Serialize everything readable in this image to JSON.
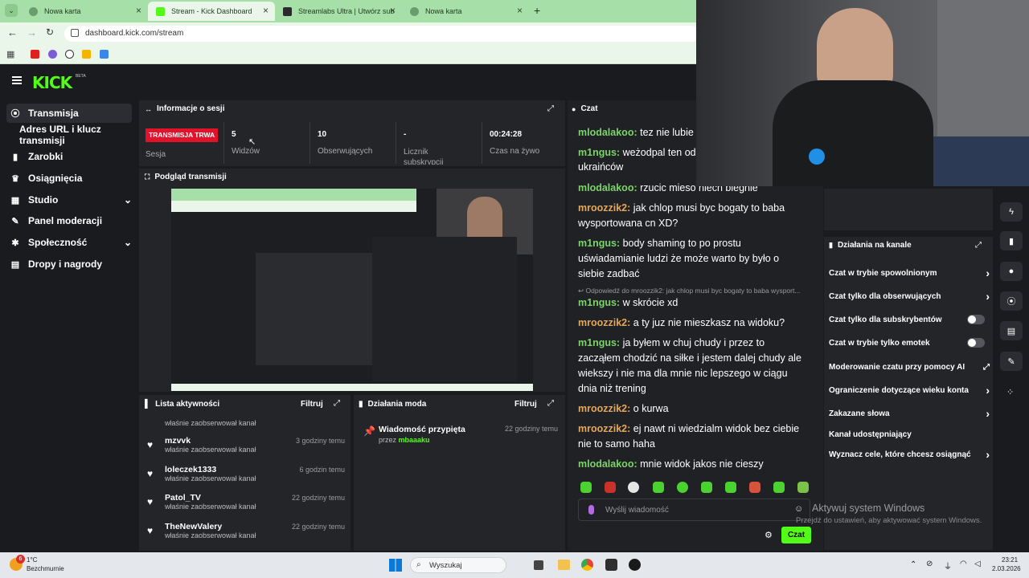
{
  "browser": {
    "tabs": [
      {
        "label": "Nowa karta"
      },
      {
        "label": "Stream - Kick Dashboard"
      },
      {
        "label": "Streamlabs Ultra | Utwórz subsk"
      },
      {
        "label": "Nowa karta"
      }
    ],
    "url": "dashboard.kick.com/stream"
  },
  "app": {
    "logo": "KICK",
    "logo_badge": "BETA"
  },
  "sidebar": {
    "items": [
      {
        "label": "Transmisja",
        "icon": "broadcast-icon"
      },
      {
        "label": "Adres URL i klucz transmisji"
      },
      {
        "label": "Zarobki",
        "icon": "chart-icon"
      },
      {
        "label": "Osiągnięcia",
        "icon": "trophy-icon"
      },
      {
        "label": "Studio",
        "icon": "grid-icon"
      },
      {
        "label": "Panel moderacji",
        "icon": "wrench-icon"
      },
      {
        "label": "Społeczność",
        "icon": "people-icon"
      },
      {
        "label": "Dropy i nagrody",
        "icon": "gift-icon"
      }
    ]
  },
  "session": {
    "title": "Informacje o sesji",
    "live_badge": "TRANSMISJA TRWA",
    "session_label": "Sesja",
    "stats": [
      {
        "value": "5",
        "label": "Widzów"
      },
      {
        "value": "10",
        "label": "Obserwujących"
      },
      {
        "value": "-",
        "label": "Licznik subskrypcji"
      },
      {
        "value": "00:24:28",
        "label": "Czas na żywo"
      }
    ]
  },
  "preview": {
    "title": "Podgląd transmisji"
  },
  "activity": {
    "title": "Lista aktywności",
    "filter_label": "Filtruj",
    "first_sub": "właśnie zaobserwował kanał",
    "rows": [
      {
        "name": "mzvvk",
        "sub": "właśnie zaobserwował kanał",
        "time": "3 godziny temu"
      },
      {
        "name": "loleczek1333",
        "sub": "właśnie zaobserwował kanał",
        "time": "6 godzin temu"
      },
      {
        "name": "Patol_TV",
        "sub": "właśnie zaobserwował kanał",
        "time": "22 godziny temu"
      },
      {
        "name": "TheNewValery",
        "sub": "właśnie zaobserwował kanał",
        "time": "22 godziny temu"
      }
    ]
  },
  "mod": {
    "title": "Działania moda",
    "filter_label": "Filtruj",
    "item_title": "Wiadomość przypięta",
    "item_by": "przez",
    "item_user": "mbaaaku",
    "item_time": "22 godziny temu"
  },
  "chat": {
    "title": "Czat",
    "messages": [
      {
        "user": "mlodalakoo:",
        "text": " tez nie lubie ",
        "style": "u1"
      },
      {
        "user": "m1ngus:",
        "text": " weżodpal ten ode",
        "style": "u3"
      },
      {
        "user": "",
        "text": "ukraińców",
        "style": ""
      },
      {
        "user": "mlodalakoo:",
        "text": " rzucic mieso niech biegnie",
        "style": "u1"
      },
      {
        "user": "mroozzik2:",
        "text": " jak chlop musi byc bogaty to baba",
        "style": "u2"
      },
      {
        "user": "",
        "text": "wysportowana cn XD?",
        "style": ""
      },
      {
        "user": "m1ngus:",
        "text": " body shaming to po prostu",
        "style": "u3"
      },
      {
        "user": "",
        "text": "uświadamianie ludzi że może warto by było o",
        "style": ""
      },
      {
        "user": "",
        "text": "siebie zadbać",
        "style": ""
      }
    ],
    "reply_hint": "Odpowiedź do mroozzik2: jak chlop musi byc bogaty to baba wysport...",
    "messages2": [
      {
        "user": "m1ngus:",
        "text": " w skrócie xd",
        "style": "u3"
      },
      {
        "user": "mroozzik2:",
        "text": " a ty juz nie mieszkasz na widoku?",
        "style": "u2"
      },
      {
        "user": "m1ngus:",
        "text": " ja byłem w chuj chudy i przez to",
        "style": "u3"
      },
      {
        "user": "",
        "text": "zacząłem chodzić na siłke i jestem dalej chudy ale",
        "style": ""
      },
      {
        "user": "",
        "text": "wiekszy i nie ma dla mnie nic lepszego w ciągu",
        "style": ""
      },
      {
        "user": "",
        "text": "dnia niż trening",
        "style": ""
      },
      {
        "user": "mroozzik2:",
        "text": " o kurwa",
        "style": "u2"
      },
      {
        "user": "mroozzik2:",
        "text": " ej nawt ni wiedzialm widok bez ciebie",
        "style": "u2"
      },
      {
        "user": "",
        "text": "nie to samo haha",
        "style": ""
      },
      {
        "user": "mlodalakoo:",
        "text": " mnie widok jakos nie cieszy",
        "style": "u1"
      }
    ],
    "input_placeholder": "Wyślij wiadomość",
    "send_label": "Czat"
  },
  "channel": {
    "title": "Działania na kanale",
    "items": [
      {
        "label": "Czat w trybie spowolnionym",
        "control": "chevron"
      },
      {
        "label": "Czat tylko dla obserwujących",
        "control": "chevron"
      },
      {
        "label": "Czat tylko dla subskrybentów",
        "control": "toggle"
      },
      {
        "label": "Czat w trybie tylko emotek",
        "control": "toggle"
      },
      {
        "label": "Moderowanie czatu przy pomocy AI",
        "control": "external"
      },
      {
        "label": "Ograniczenie dotyczące wieku konta",
        "control": "chevron"
      },
      {
        "label": "Zakazane słowa",
        "control": "chevron"
      },
      {
        "label": "Kanał udostępniający",
        "control": "none"
      },
      {
        "label": "Wyznacz cele, które chcesz osiągnąć",
        "control": "chevron"
      }
    ]
  },
  "watermark": {
    "line1": "Aktywuj system Windows",
    "line2": "Przejdź do ustawień, aby aktywować system Windows."
  },
  "taskbar": {
    "weather_temp": "1°C",
    "weather_desc": "Bezchmurnie",
    "search_placeholder": "Wyszukaj",
    "time": "23:21",
    "date": "2.03.2026",
    "notif_count": "6"
  },
  "colors": {
    "accent": "#53fc18",
    "live": "#e3122b",
    "tabbar": "#a6dfa7"
  }
}
